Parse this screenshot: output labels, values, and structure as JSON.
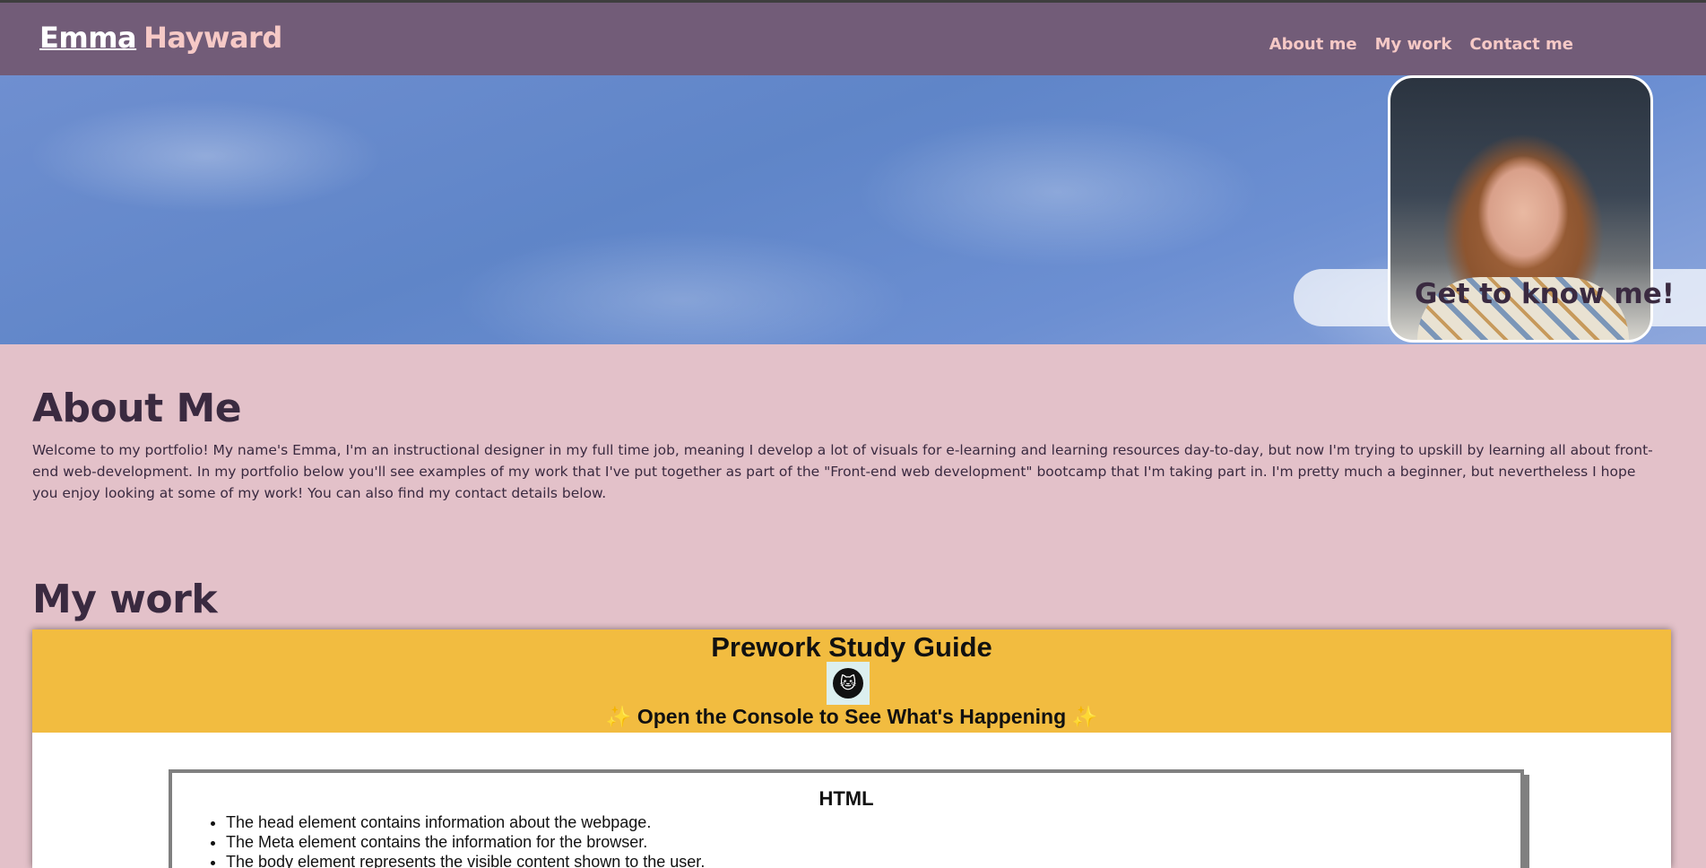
{
  "header": {
    "first_name": "Emma",
    "last_name": "Hayward",
    "nav": [
      "About me",
      "My work",
      "Contact me"
    ]
  },
  "hero": {
    "cta": "Get to know me!"
  },
  "about": {
    "title": "About Me",
    "text": "Welcome to my portfolio! My name's Emma, I'm an instructional designer in my full time job, meaning I develop a lot of visuals for e-learning and learning resources day-to-day, but now I'm trying to upskill by learning all about front-end web-development. In my portfolio below you'll see examples of my work that I've put together as part of the \"Front-end web development\" bootcamp that I'm taking part in. I'm pretty much a beginner, but nevertheless I hope you enjoy looking at some of my work! You can also find my contact details below."
  },
  "work": {
    "title": "My work",
    "project": {
      "title": "Prework Study Guide",
      "subtitle": "Open the Console to See What's Happening",
      "card_title": "HTML",
      "items": [
        "The head element contains information about the webpage.",
        "The Meta element contains the information for the browser.",
        "The body element represents the visible content shown to the user."
      ]
    }
  },
  "colors": {
    "topbar": "#725c78",
    "page_bg": "#e3c1c9",
    "accent_pink": "#f6c9c6",
    "text_dark": "#3a2a40",
    "project_header": "#f2bc40"
  },
  "icons": {
    "sparkle": "sparkles-icon",
    "logo": "cat-logo-icon"
  }
}
